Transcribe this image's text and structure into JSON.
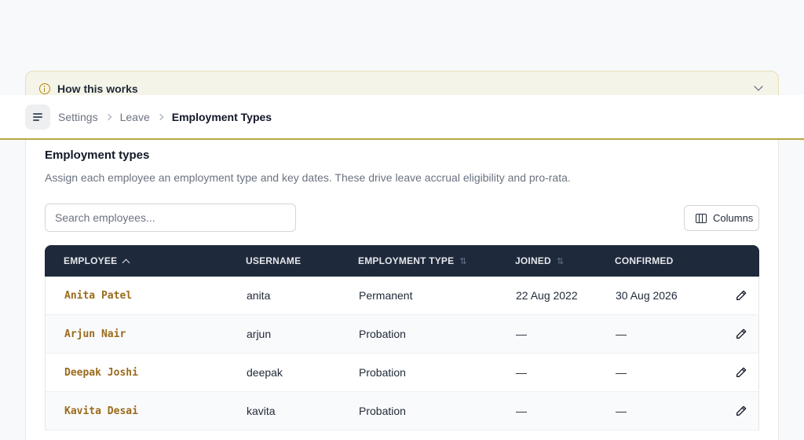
{
  "banner": {
    "label": "How this works"
  },
  "breadcrumb": [
    "Settings",
    "Leave",
    "Employment Types"
  ],
  "card": {
    "title": "Employment types",
    "description": "Assign each employee an employment type and key dates. These drive leave accrual eligibility and pro-rata."
  },
  "search": {
    "placeholder": "Search employees..."
  },
  "columns_button": "Columns",
  "table": {
    "headers": [
      "EMPLOYEE",
      "USERNAME",
      "EMPLOYMENT TYPE",
      "JOINED",
      "CONFIRMED"
    ],
    "sort": {
      "employee": "ascending",
      "employment_type": "sortable",
      "joined": "sortable"
    },
    "rows": [
      {
        "employee": "Anita Patel",
        "username": "anita",
        "type": "Permanent",
        "joined": "22 Aug 2022",
        "confirmed": "30 Aug 2026"
      },
      {
        "employee": "Arjun Nair",
        "username": "arjun",
        "type": "Probation",
        "joined": "—",
        "confirmed": "—"
      },
      {
        "employee": "Deepak Joshi",
        "username": "deepak",
        "type": "Probation",
        "joined": "—",
        "confirmed": "—"
      },
      {
        "employee": "Kavita Desai",
        "username": "kavita",
        "type": "Probation",
        "joined": "—",
        "confirmed": "—"
      }
    ]
  },
  "icons": {
    "banner": "info-icon",
    "expand": "chevron-down-icon",
    "menu": "menu-icon",
    "columns": "columns-icon",
    "edit": "pencil-icon"
  },
  "colors": {
    "accent": "#b9a642",
    "header_bg": "#1e293b",
    "name_link": "#9a6b1c"
  }
}
